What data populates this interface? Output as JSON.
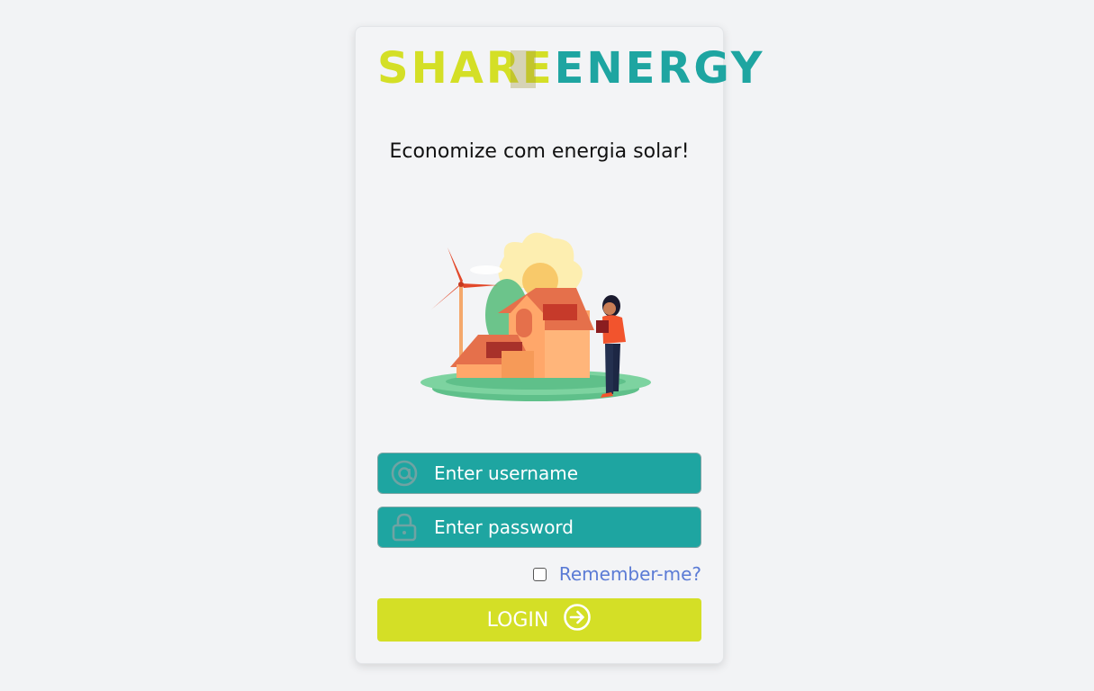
{
  "brand": {
    "part1": "SHARE",
    "part2": "ENERGY"
  },
  "tagline": "Economize com energia solar!",
  "form": {
    "username_placeholder": "Enter username",
    "password_placeholder": "Enter password",
    "remember_label": "Remember-me?",
    "remember_checked": false,
    "login_label": "LOGIN"
  },
  "icons": {
    "username": "at-icon",
    "password": "lock-icon",
    "login": "arrow-right-circle-icon"
  },
  "colors": {
    "teal": "#1ea5a1",
    "lime": "#d4df26",
    "link": "#5b7bd5",
    "background": "#f2f3f5"
  }
}
